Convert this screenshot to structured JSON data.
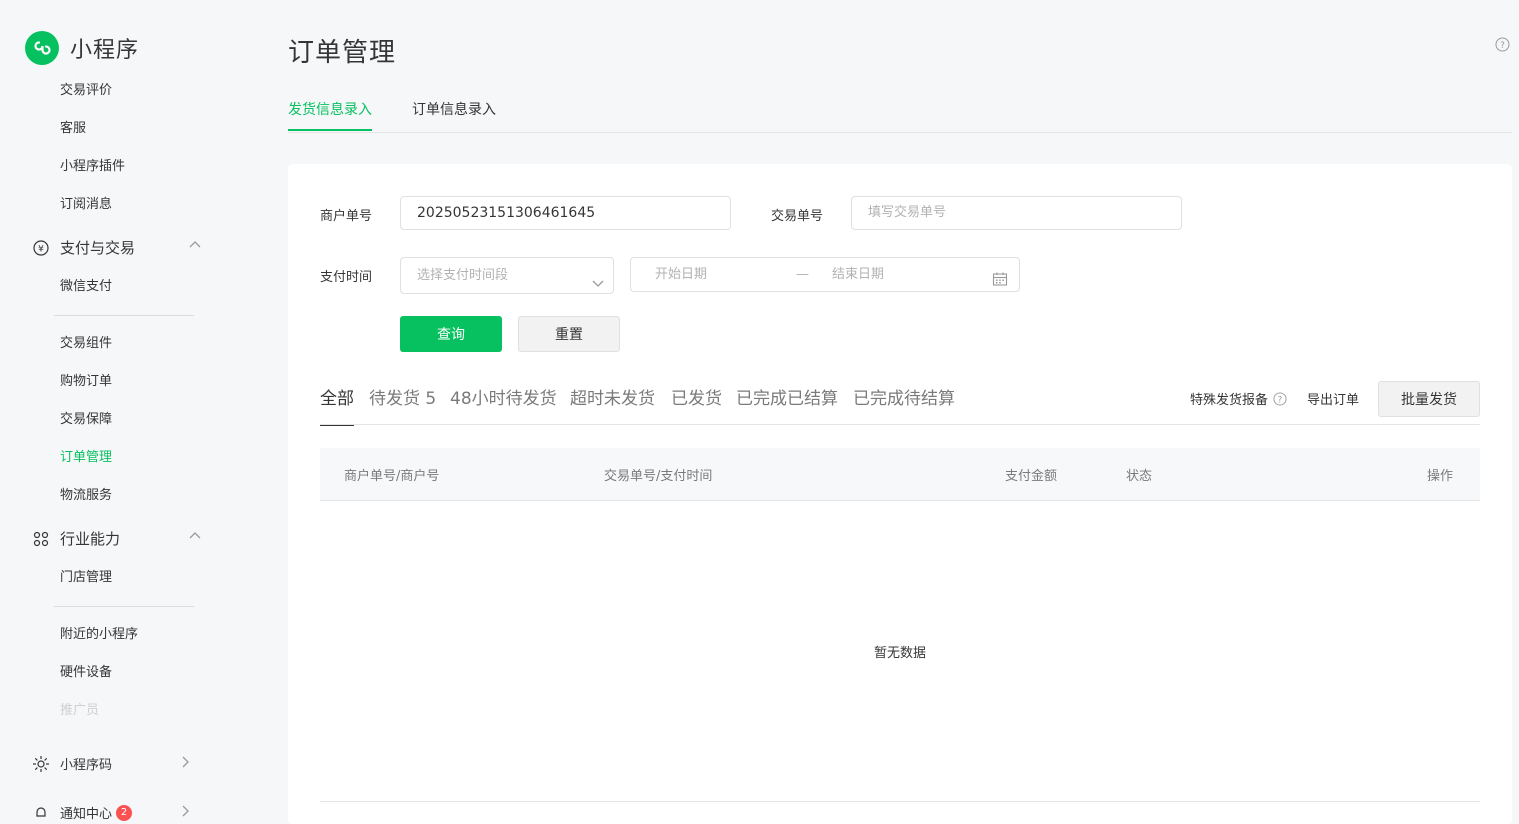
{
  "app": {
    "title": "小程序"
  },
  "sidebar": {
    "items_top": [
      {
        "label": "交易评价"
      },
      {
        "label": "客服"
      },
      {
        "label": "小程序插件"
      },
      {
        "label": "订阅消息"
      }
    ],
    "group_payment": {
      "label": "支付与交易",
      "icon": "yuan-circle-icon"
    },
    "payment_items_a": [
      {
        "label": "微信支付"
      }
    ],
    "payment_items_b": [
      {
        "label": "交易组件"
      },
      {
        "label": "购物订单"
      },
      {
        "label": "交易保障"
      },
      {
        "label": "订单管理",
        "active": true
      },
      {
        "label": "物流服务"
      }
    ],
    "group_industry": {
      "label": "行业能力",
      "icon": "nodes-icon"
    },
    "industry_items_a": [
      {
        "label": "门店管理"
      }
    ],
    "industry_items_b": [
      {
        "label": "附近的小程序"
      },
      {
        "label": "硬件设备"
      },
      {
        "label": "推广员"
      }
    ],
    "group_qrcode": {
      "label": "小程序码",
      "icon": "sun-icon"
    },
    "group_notify": {
      "label": "通知中心",
      "badge": "2",
      "icon": "bell-icon"
    }
  },
  "page": {
    "title": "订单管理",
    "tabs": [
      {
        "label": "发货信息录入",
        "active": true
      },
      {
        "label": "订单信息录入"
      }
    ]
  },
  "form": {
    "merchant_no_label": "商户单号",
    "merchant_no_value": "2025052315130646164​5",
    "trade_no_label": "交易单号",
    "trade_no_placeholder": "填写交易单号",
    "pay_time_label": "支付时间",
    "pay_time_placeholder": "选择支付时间段",
    "start_date_placeholder": "开始日期",
    "date_separator": "—",
    "end_date_placeholder": "结束日期",
    "query_button": "查询",
    "reset_button": "重置"
  },
  "filters": {
    "tabs": [
      {
        "label": "全部",
        "active": true
      },
      {
        "label": "待发货 5"
      },
      {
        "label": "48小时待发货"
      },
      {
        "label": "超时未发货"
      },
      {
        "label": "已发货"
      },
      {
        "label": "已完成已结算"
      },
      {
        "label": "已完成待结算"
      }
    ],
    "special_report": "特殊发货报备",
    "export": "导出订单",
    "batch_ship": "批量发货"
  },
  "table": {
    "columns": [
      "商户单号/商户号",
      "交易单号/支付时间",
      "支付金额",
      "状态",
      "操作"
    ],
    "empty_text": "暂无数据"
  },
  "colors": {
    "brand": "#07c160",
    "badge": "#fa5151"
  }
}
